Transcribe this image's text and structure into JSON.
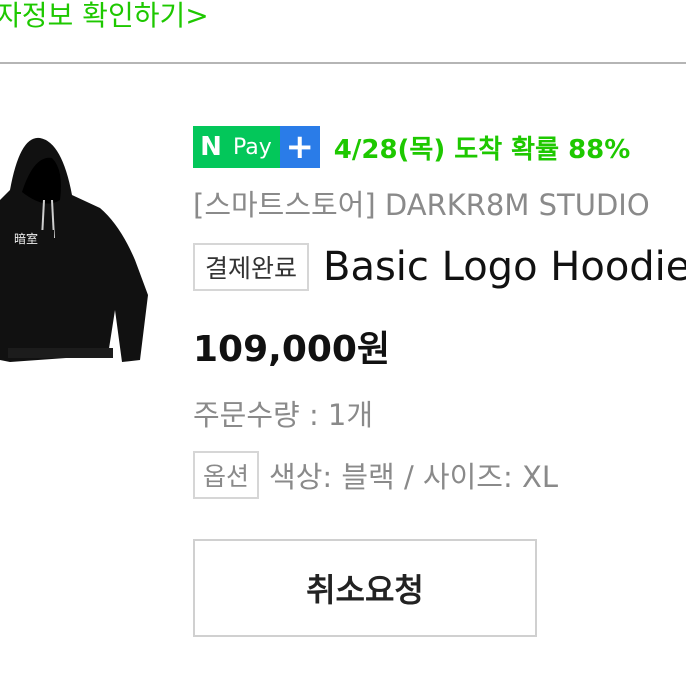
{
  "header": {
    "link_text": "자정보 확인하기>"
  },
  "product": {
    "npay": {
      "n_label": "N",
      "pay_label": "Pay",
      "plus_label": "+"
    },
    "delivery_estimate": "4/28(목) 도착 확률 88%",
    "store": "[스마트스토어] DARKR8M STUDIO",
    "status_badge": "결제완료",
    "name": "Basic Logo Hoodie",
    "price": "109,000원",
    "quantity": "주문수량 : 1개",
    "option_label": "옵션",
    "option_value": "색상: 블랙 / 사이즈: XL",
    "cancel_button": "취소요청",
    "image_alt": "black hoodie"
  },
  "colors": {
    "naver_green": "#03c75a",
    "link_green": "#1ec800",
    "npay_plus_blue": "#2a7ce8"
  }
}
